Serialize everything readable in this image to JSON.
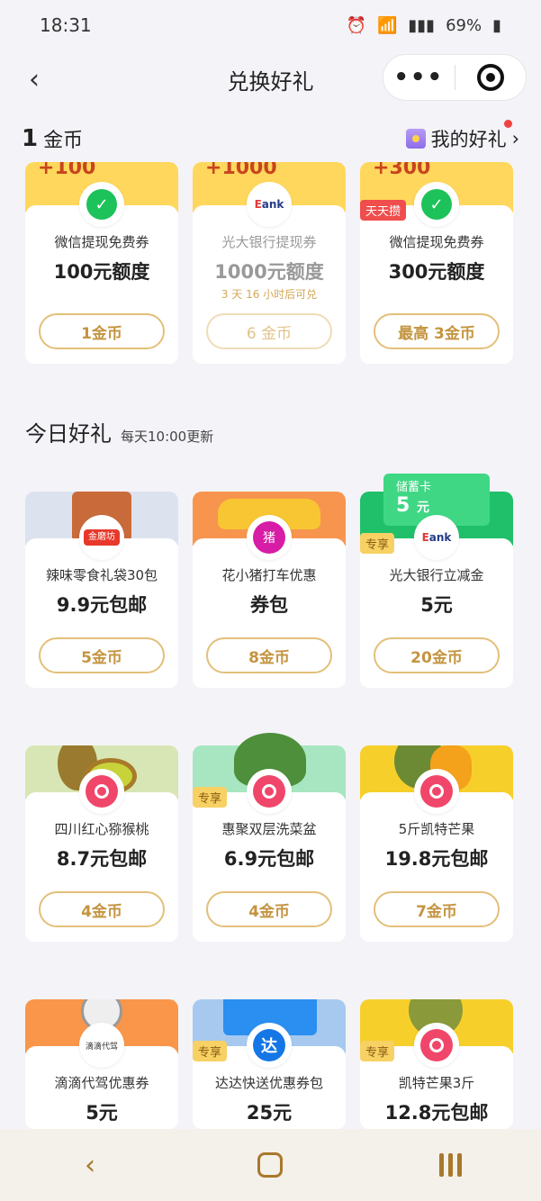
{
  "status": {
    "time": "18:31",
    "battery": "69%"
  },
  "header": {
    "title": "兑换好礼"
  },
  "coins": {
    "count": "1",
    "unit": "金币",
    "my_gifts": "我的好礼"
  },
  "top_cards": [
    {
      "amount": "100",
      "name": "微信提现免费券",
      "price": "100元额度",
      "sub": "",
      "btn": "1金币",
      "tag": ""
    },
    {
      "amount": "1000",
      "name": "光大银行提现券",
      "price": "1000元额度",
      "sub": "3 天 16 小时后可兑",
      "btn": "6 金币",
      "tag": ""
    },
    {
      "amount": "300",
      "name": "微信提现免费券",
      "price": "300元额度",
      "sub": "",
      "btn": "最高 3金币",
      "tag": "天天攒"
    }
  ],
  "section": {
    "title": "今日好礼",
    "subtitle": "每天10:00更新"
  },
  "rows": [
    [
      {
        "name": "辣味零食礼袋30包",
        "price": "9.9元包邮",
        "btn": "5金币",
        "tag": ""
      },
      {
        "name": "花小猪打车优惠",
        "price": "券包",
        "btn": "8金币",
        "tag": ""
      },
      {
        "name": "光大银行立减金",
        "price": "5元",
        "btn": "20金币",
        "tag": "专享",
        "card_label": "储蓄卡",
        "card_value": "5"
      }
    ],
    [
      {
        "name": "四川红心猕猴桃",
        "price": "8.7元包邮",
        "btn": "4金币",
        "tag": ""
      },
      {
        "name": "惠聚双层洗菜盆",
        "price": "6.9元包邮",
        "btn": "4金币",
        "tag": "专享"
      },
      {
        "name": "5斤凯特芒果",
        "price": "19.8元包邮",
        "btn": "7金币",
        "tag": ""
      }
    ],
    [
      {
        "name": "滴滴代驾优惠券",
        "price": "5元",
        "btn": "",
        "tag": ""
      },
      {
        "name": "达达快送优惠券包",
        "price": "25元",
        "btn": "",
        "tag": "专享"
      },
      {
        "name": "凯特芒果3斤",
        "price": "12.8元包邮",
        "btn": "",
        "tag": "专享"
      }
    ]
  ],
  "colors": {
    "accent": "#c49440",
    "card_yellow": "#ffd75c",
    "green": "#1ec25a"
  }
}
